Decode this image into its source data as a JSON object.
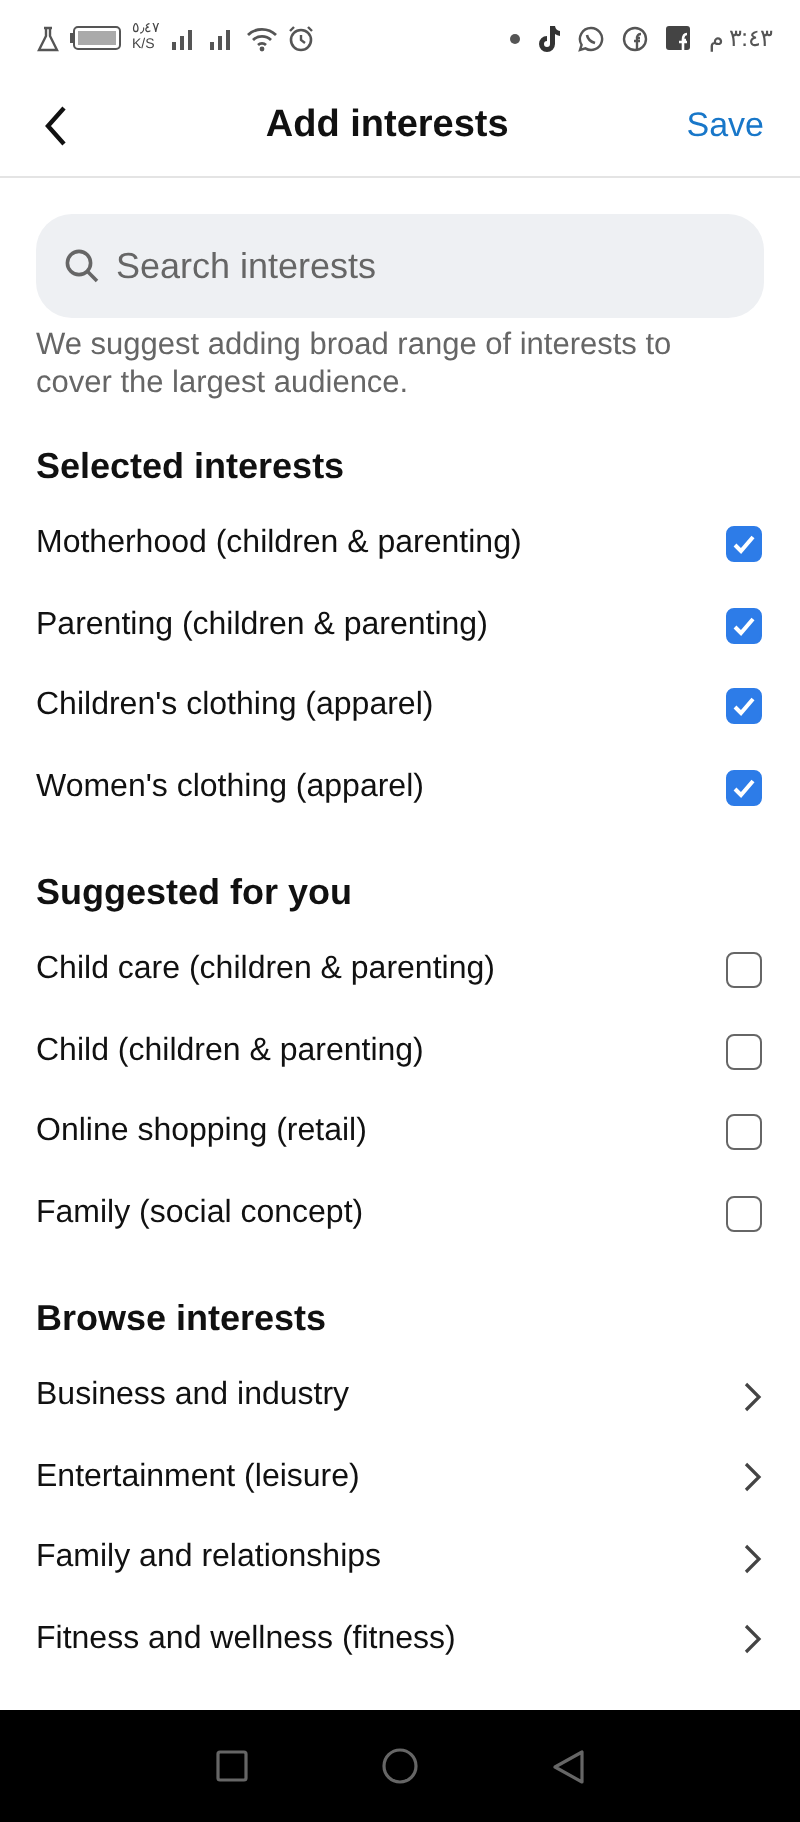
{
  "status_bar": {
    "speed": "٥٫٤٧",
    "speed_unit": "K/S",
    "time": "٣:٤٣ م"
  },
  "header": {
    "title": "Add interests",
    "action": "Save"
  },
  "search": {
    "placeholder": "Search interests"
  },
  "hint": "We suggest adding broad range of interests to cover the largest audience.",
  "sections": [
    {
      "kind": "checklist",
      "title": "Selected interests",
      "items": [
        {
          "label": "Motherhood (children & parenting)",
          "checked": true
        },
        {
          "label": "Parenting (children & parenting)",
          "checked": true
        },
        {
          "label": "Children's clothing (apparel)",
          "checked": true
        },
        {
          "label": "Women's clothing (apparel)",
          "checked": true
        }
      ]
    },
    {
      "kind": "checklist",
      "title": "Suggested for you",
      "items": [
        {
          "label": "Child care (children & parenting)",
          "checked": false
        },
        {
          "label": "Child (children & parenting)",
          "checked": false
        },
        {
          "label": "Online shopping (retail)",
          "checked": false
        },
        {
          "label": "Family (social concept)",
          "checked": false
        }
      ]
    },
    {
      "kind": "browse",
      "title": "Browse interests",
      "items": [
        {
          "label": "Business and industry"
        },
        {
          "label": "Entertainment (leisure)"
        },
        {
          "label": "Family and relationships"
        },
        {
          "label": "Fitness and wellness (fitness)"
        }
      ]
    }
  ]
}
